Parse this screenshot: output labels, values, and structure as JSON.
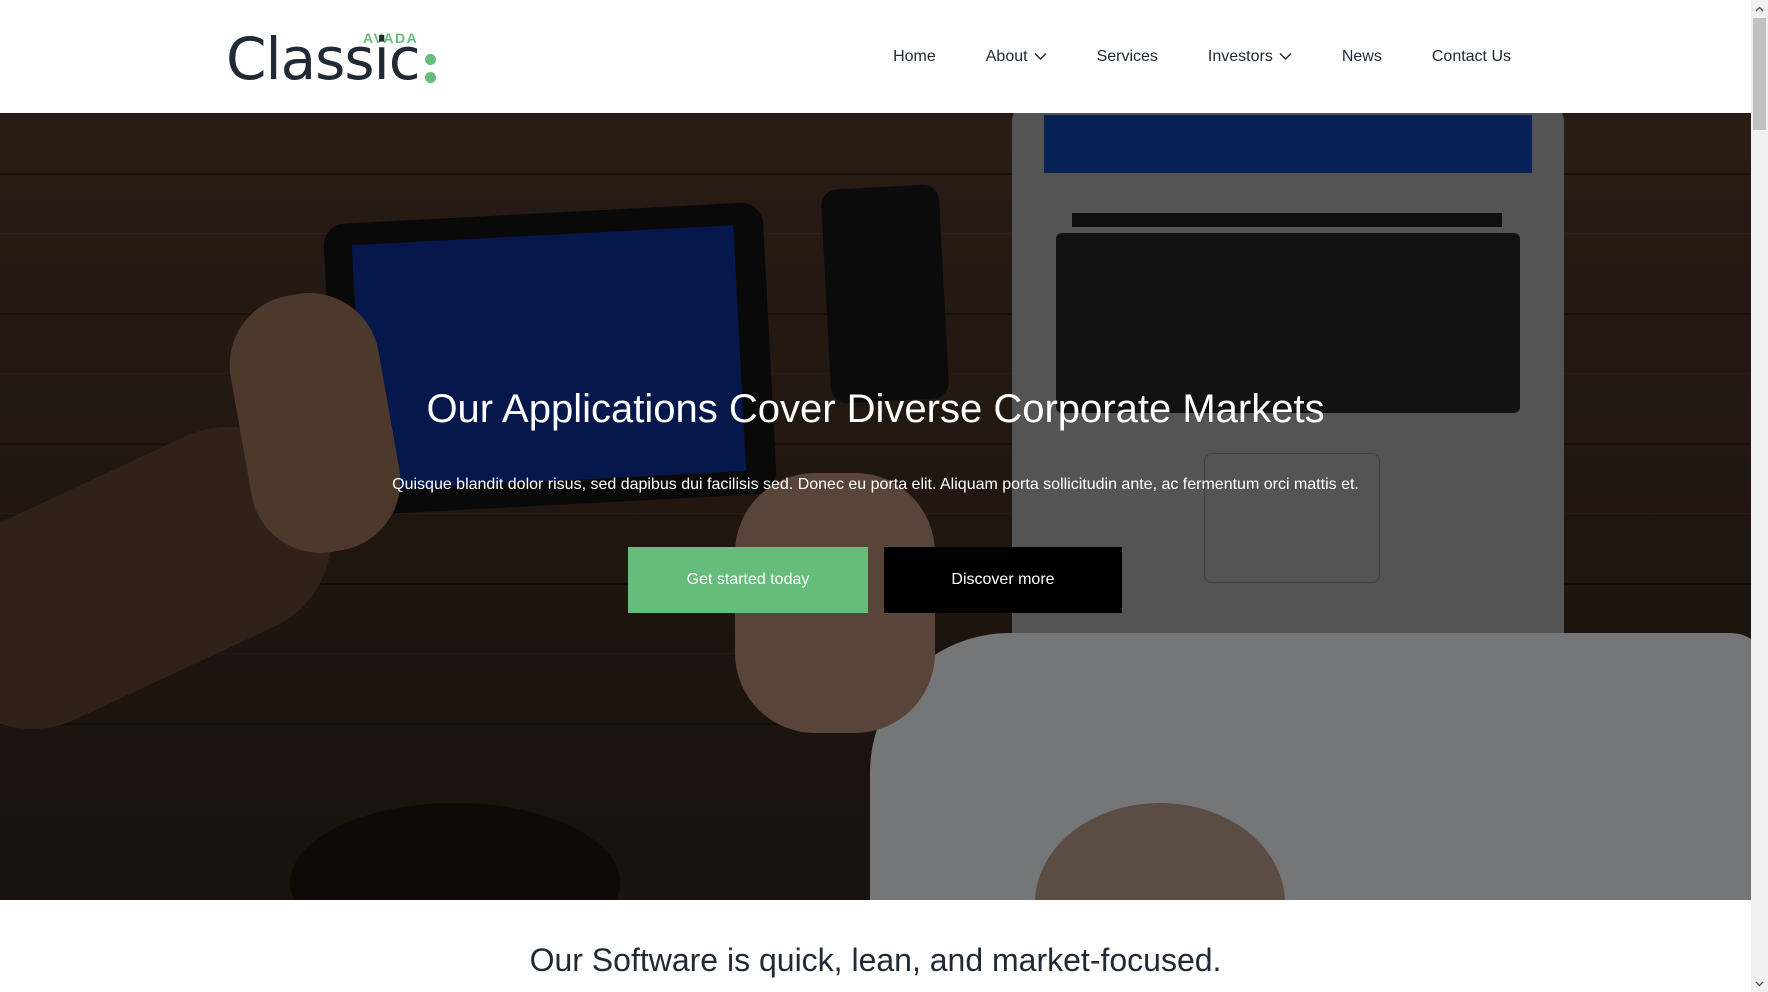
{
  "brand": {
    "small_text": "AVADA",
    "main_text": "Classic",
    "accent_color": "#65bc7b"
  },
  "nav": {
    "items": [
      {
        "label": "Home",
        "has_dropdown": false
      },
      {
        "label": "About",
        "has_dropdown": true
      },
      {
        "label": "Services",
        "has_dropdown": false
      },
      {
        "label": "Investors",
        "has_dropdown": true
      },
      {
        "label": "News",
        "has_dropdown": false
      },
      {
        "label": "Contact Us",
        "has_dropdown": false
      }
    ]
  },
  "hero": {
    "title": "Our Applications Cover Diverse Corporate Markets",
    "subtitle": "Quisque blandit dolor risus, sed dapibus dui facilisis sed. Donec eu porta elit. Aliquam porta sollicitudin ante, ac fermentum orci mattis et.",
    "primary_button": "Get started today",
    "secondary_button": "Discover more",
    "primary_color": "#65bc7b",
    "secondary_color": "#000000"
  },
  "section": {
    "title": "Our Software is quick, lean, and market-focused."
  },
  "icons": {
    "dropdown": "chevron-down-icon",
    "scroll_up": "scroll-up-arrow-icon",
    "scroll_down": "scroll-down-arrow-icon"
  }
}
